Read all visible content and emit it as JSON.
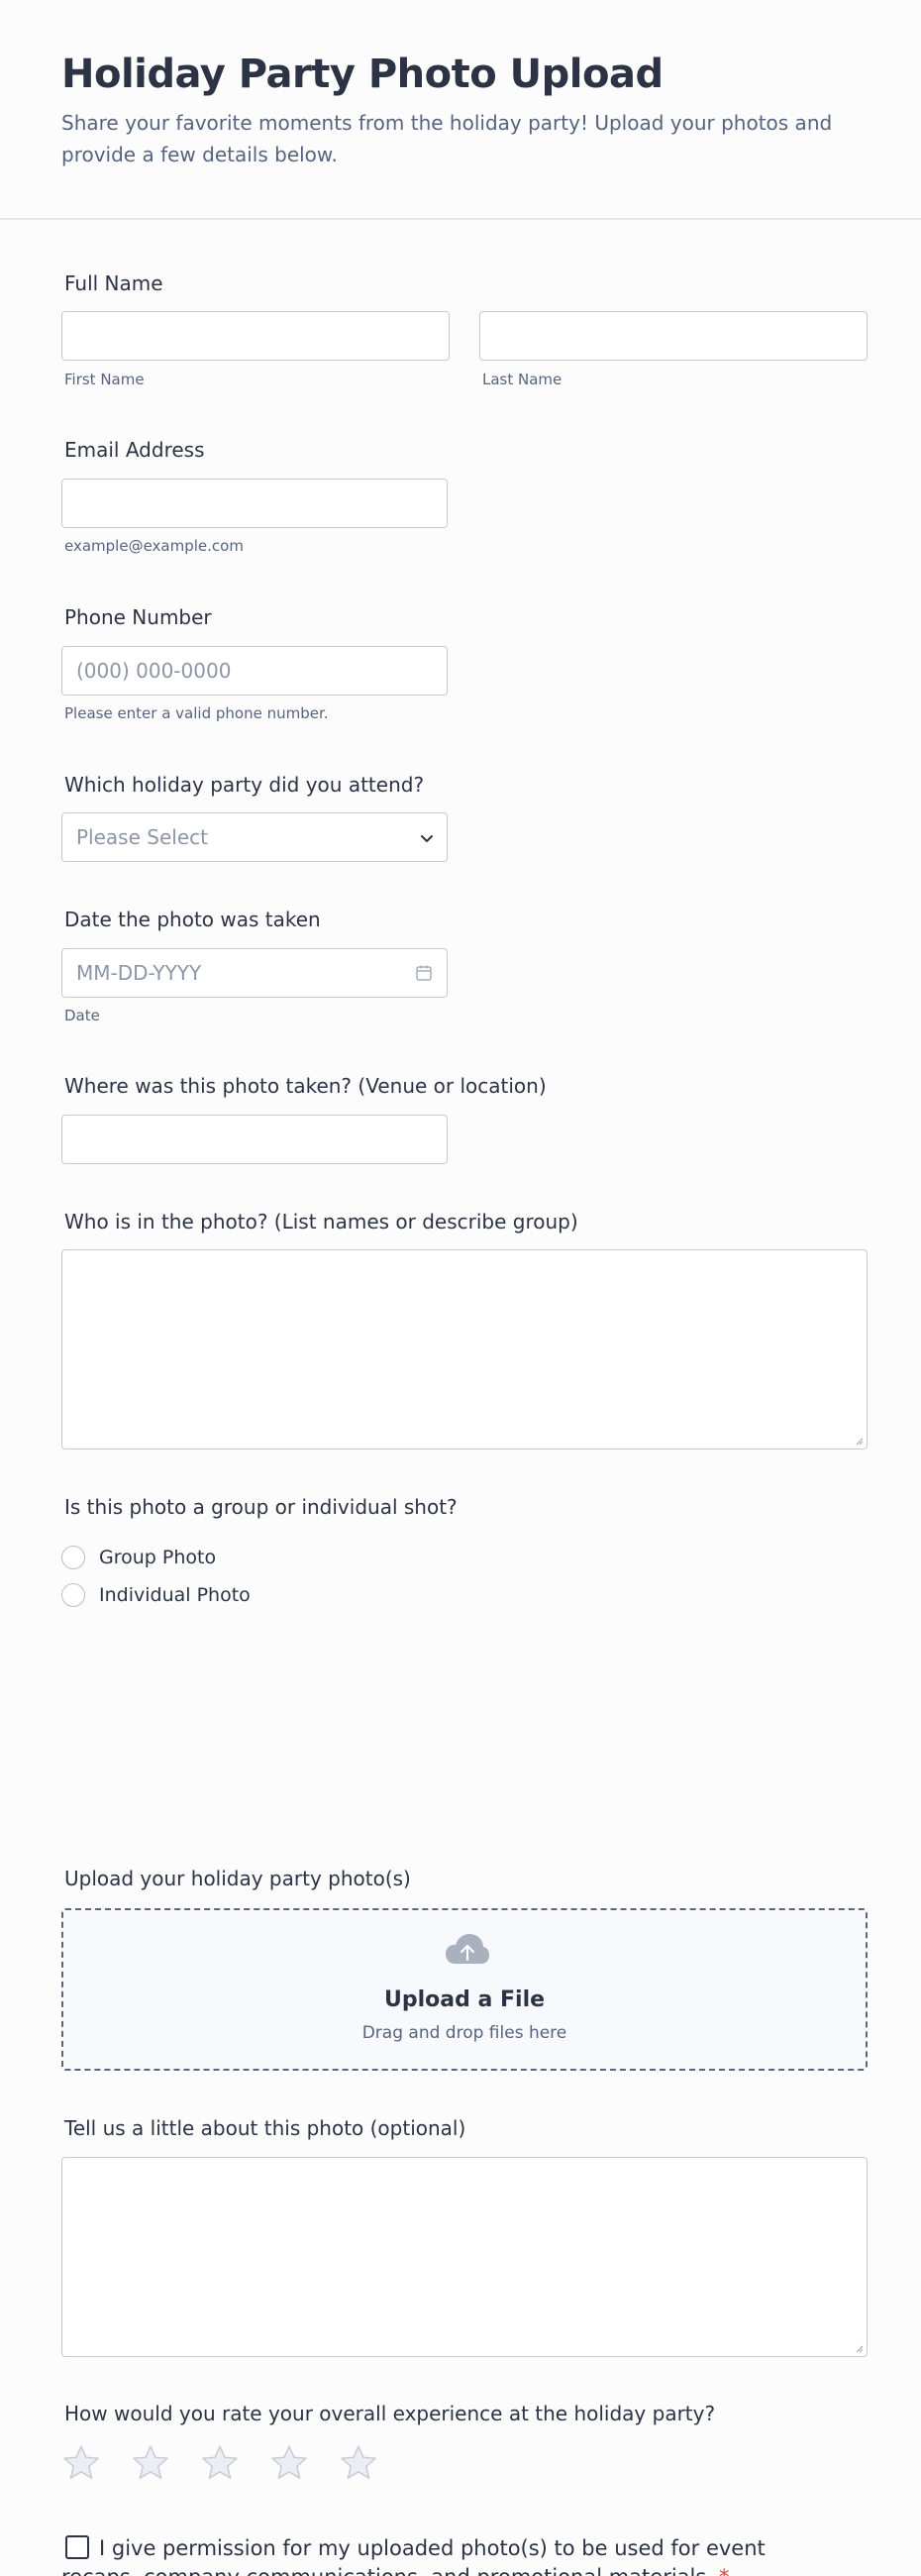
{
  "header": {
    "title": "Holiday Party Photo Upload",
    "description": "Share your favorite moments from the holiday party! Upload your photos and provide a few details below."
  },
  "full_name": {
    "label": "Full Name",
    "first_sublabel": "First Name",
    "last_sublabel": "Last Name"
  },
  "email": {
    "label": "Email Address",
    "sublabel": "example@example.com"
  },
  "phone": {
    "label": "Phone Number",
    "placeholder": "(000) 000-0000",
    "sublabel": "Please enter a valid phone number."
  },
  "party_select": {
    "label": "Which holiday party did you attend?",
    "placeholder": "Please Select",
    "icon": "chevron-down-icon"
  },
  "date": {
    "label": "Date the photo was taken",
    "placeholder": "MM-DD-YYYY",
    "sublabel": "Date",
    "icon": "calendar-icon"
  },
  "location": {
    "label": "Where was this photo taken? (Venue or location)"
  },
  "people": {
    "label": "Who is in the photo? (List names or describe group)"
  },
  "shot_type": {
    "label": "Is this photo a group or individual shot?",
    "options": [
      "Group Photo",
      "Individual Photo"
    ]
  },
  "upload": {
    "label": "Upload your holiday party photo(s)",
    "title": "Upload a File",
    "subtitle": "Drag and drop files here",
    "icon": "cloud-upload-icon"
  },
  "about": {
    "label": "Tell us a little about this photo (optional)"
  },
  "rating": {
    "label": "How would you rate your overall experience at the holiday party?",
    "max": 5,
    "value": 0,
    "icon": "star-icon"
  },
  "consent": {
    "text": "I give permission for my uploaded photo(s) to be used for event recaps, company communications, and promotional materials.",
    "required_mark": "*"
  },
  "colors": {
    "text": "#2c3345",
    "muted": "#57647e",
    "border": "#c3cad8",
    "required": "#e8452c"
  }
}
